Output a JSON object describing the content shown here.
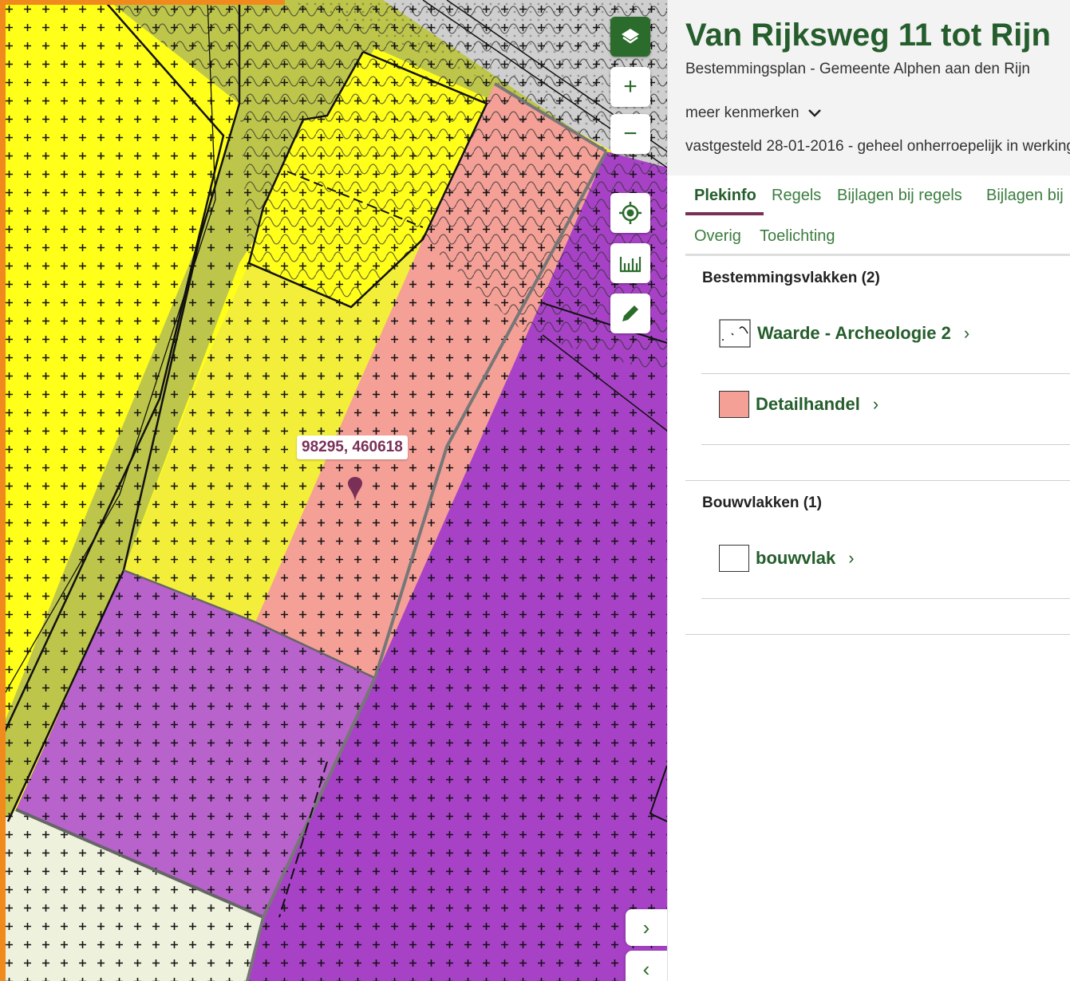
{
  "map": {
    "coordinate_label": "98295, 460618",
    "controls": {
      "layers": "layers-icon",
      "zoom_in": "+",
      "zoom_out": "−",
      "locate": "locate-icon",
      "measure": "measure-icon",
      "draw": "pencil-icon"
    },
    "colors": {
      "yellow": "#ffff1a",
      "olive": "#bdc64a",
      "lightyellow": "#f2ee3a",
      "salmon": "#f4a097",
      "purple": "#a742c7",
      "lightpurple": "#b863cc",
      "cream": "#eef1dc",
      "grey": "#cfcfcf"
    }
  },
  "panel": {
    "title": "Van Rijksweg 11 tot Rijn",
    "subtitle": "Bestemmingsplan - Gemeente Alphen aan den Rijn",
    "meer": "meer kenmerken",
    "status": "vastgesteld 28-01-2016 - geheel onherroepelijk in werking",
    "tabs": [
      "Plekinfo",
      "Regels",
      "Bijlagen bij regels",
      "Bijlagen bij",
      "Overig",
      "Toelichting"
    ],
    "sections": {
      "bestemmingsvlakken": {
        "heading": "Bestemmingsvlakken (2)",
        "items": [
          {
            "label": "Waarde - Archeologie 2",
            "color": "#ffffff"
          },
          {
            "label": "Detailhandel",
            "color": "#f4a097"
          }
        ]
      },
      "bouwvlakken": {
        "heading": "Bouwvlakken (1)",
        "items": [
          {
            "label": "bouwvlak",
            "color": "#ffffff"
          }
        ]
      }
    }
  }
}
